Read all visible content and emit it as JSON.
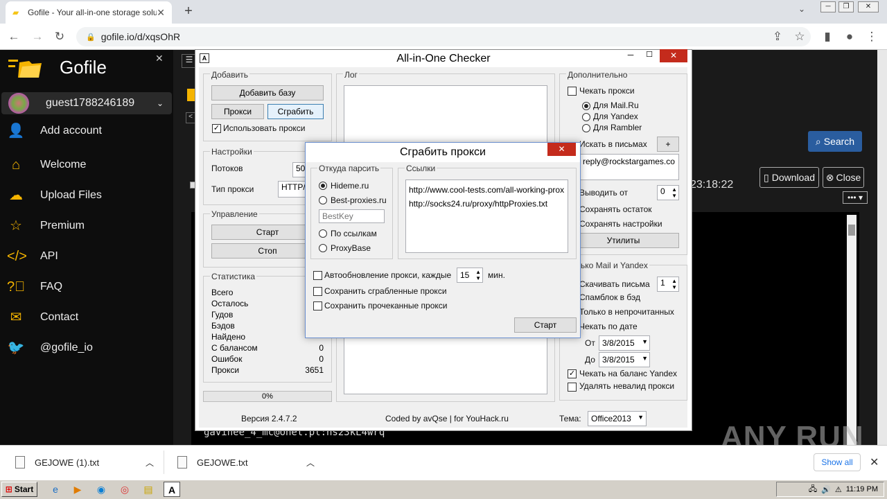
{
  "browser": {
    "tab_title": "Gofile - Your all-in-one storage soluti",
    "url": "gofile.io/d/xqsOhR"
  },
  "gofile": {
    "brand": "Gofile",
    "username": "guest1788246189",
    "menu": [
      {
        "label": "Add account",
        "icon": "add-user-icon"
      },
      {
        "label": "Welcome",
        "icon": "home-icon"
      },
      {
        "label": "Upload Files",
        "icon": "upload-icon"
      },
      {
        "label": "Premium",
        "icon": "star-icon"
      },
      {
        "label": "API",
        "icon": "code-icon"
      },
      {
        "label": "FAQ",
        "icon": "question-icon"
      },
      {
        "label": "Contact",
        "icon": "mail-icon"
      },
      {
        "label": "@gofile_io",
        "icon": "twitter-icon"
      }
    ],
    "search_label": "Search",
    "download_label": "Download",
    "close_label": "Close",
    "time_text": "23:18:22",
    "more_label": "•••",
    "viewer_line": "gavinee_4_mc@onet.pl:hs23kL4wrq"
  },
  "checker": {
    "title": "All-in-One Checker",
    "add_group": "Добавить",
    "add_base": "Добавить базу",
    "proxy_btn": "Прокси",
    "grab_btn": "Сграбить",
    "use_proxy": "Использовать прокси",
    "settings_group": "Настройки",
    "threads_label": "Потоков",
    "threads_value": "50",
    "proxy_type_label": "Тип прокси",
    "proxy_type_value": "HTTP/S",
    "control_group": "Управление",
    "start_btn": "Старт",
    "stop_btn": "Стоп",
    "stats_group": "Статистика",
    "stats": [
      {
        "label": "Всего",
        "value": ""
      },
      {
        "label": "Осталось",
        "value": ""
      },
      {
        "label": "Гудов",
        "value": ""
      },
      {
        "label": "Бэдов",
        "value": ""
      },
      {
        "label": "Найдено",
        "value": ""
      },
      {
        "label": "С балансом",
        "value": "0"
      },
      {
        "label": "Ошибок",
        "value": "0"
      },
      {
        "label": "Прокси",
        "value": "3651"
      }
    ],
    "progress": "0%",
    "log_group": "Лог",
    "extra_group": "Дополнительно",
    "check_proxy": "Чекать прокси",
    "radio_mailru": "Для Mail.Ru",
    "radio_yandex": "Для Yandex",
    "radio_rambler": "Для Rambler",
    "search_in_mail": "Искать в письмах",
    "plus": "+",
    "search_text": "reply@rockstargames.co",
    "output_from": "Выводить от",
    "output_from_value": "0",
    "save_rest": "Сохранять остаток",
    "save_settings": "Сохранять настройки",
    "utilities": "Утилиты",
    "mail_yandex_group": "ько Mail и Yandex",
    "download_mails": "Скачивать письма",
    "download_mails_value": "1",
    "spamblock": "Спамблок в бэд",
    "only_unread": "Только в непрочитанных",
    "check_by_date": "Чекать по дате",
    "from_label": "От",
    "from_date": "3/8/2015",
    "to_label": "До",
    "to_date": "3/8/2015",
    "check_yandex_balance": "Чекать на баланс Yandex",
    "delete_invalid_proxy": "Удалять невалид прокси",
    "version": "Версия 2.4.7.2",
    "coded_by": "Coded by avQse | for YouHack.ru",
    "theme_label": "Тема:",
    "theme_value": "Office2013"
  },
  "dialog": {
    "title": "Сграбить прокси",
    "source_group": "Откуда парсить",
    "links_group": "Ссылки",
    "opt_hideme": "Hideme.ru",
    "opt_bestproxies": "Best-proxies.ru",
    "bestkey_placeholder": "BestKey",
    "opt_bylinks": "По ссылкам",
    "opt_proxybase": "ProxyBase",
    "links": [
      "http://www.cool-tests.com/all-working-prox",
      "http://socks24.ru/proxy/httpProxies.txt"
    ],
    "auto_update": "Автообновление прокси, каждые",
    "auto_update_value": "15",
    "minutes": "мин.",
    "save_grabbed": "Сохранить сграбленные прокси",
    "save_checked": "Сохранить прочеканные прокси",
    "start": "Старт"
  },
  "downloads": {
    "items": [
      "GEJOWE (1).txt",
      "GEJOWE.txt"
    ],
    "show_all": "Show all"
  },
  "taskbar": {
    "start": "Start",
    "clock": "11:19 PM"
  },
  "watermark": "ANY RUN"
}
